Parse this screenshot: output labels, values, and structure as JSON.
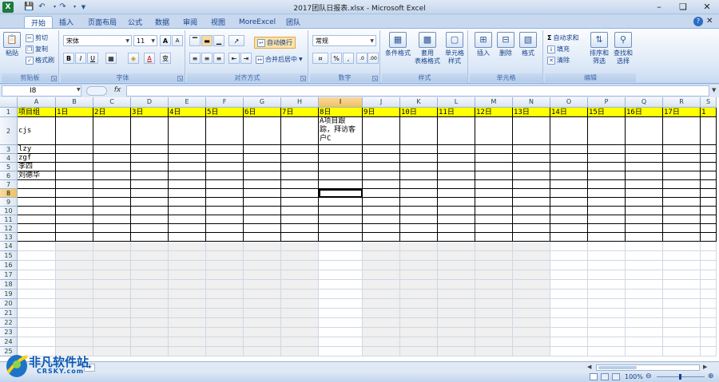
{
  "window": {
    "title": "2017团队日报表.xlsx - Microsoft Excel"
  },
  "tabs": [
    {
      "label": "开始"
    },
    {
      "label": "插入"
    },
    {
      "label": "页面布局"
    },
    {
      "label": "公式"
    },
    {
      "label": "数据"
    },
    {
      "label": "审阅"
    },
    {
      "label": "视图"
    },
    {
      "label": "MoreExcel"
    },
    {
      "label": "团队"
    }
  ],
  "ribbon": {
    "clipboard": {
      "label": "剪贴板",
      "paste": "粘贴",
      "cut": "剪切",
      "copy": "复制",
      "format_painter": "格式刷"
    },
    "font": {
      "label": "字体",
      "name": "宋体",
      "size": "11",
      "bold": "B",
      "italic": "I",
      "underline": "U",
      "grow": "A",
      "shrink": "A",
      "font_color": "A",
      "phonetic": "变"
    },
    "alignment": {
      "label": "对齐方式",
      "wrap": "自动换行",
      "merge": "合并后居中"
    },
    "number": {
      "label": "数字",
      "format": "常规",
      "percent": "%",
      "comma": ","
    },
    "styles": {
      "label": "样式",
      "conditional": "条件格式",
      "table": "套用",
      "table2": "表格格式",
      "cell_styles": "单元格",
      "cell_styles2": "样式"
    },
    "cells": {
      "label": "单元格",
      "insert": "插入",
      "delete": "删除",
      "format": "格式"
    },
    "editing": {
      "label": "编辑",
      "autosum": "自动求和",
      "fill": "填充",
      "clear": "清除",
      "sort": "排序和",
      "sort2": "筛选",
      "find": "查找和",
      "find2": "选择"
    }
  },
  "formula_bar": {
    "name_box": "I8",
    "fx": "fx",
    "content": ""
  },
  "columns": [
    "A",
    "B",
    "C",
    "D",
    "E",
    "F",
    "G",
    "H",
    "I",
    "J",
    "K",
    "L",
    "M",
    "N",
    "O",
    "P",
    "Q",
    "R",
    "S"
  ],
  "rows": [
    "1",
    "2",
    "3",
    "4",
    "5",
    "6",
    "7",
    "8",
    "9",
    "10",
    "11",
    "12",
    "13",
    "14",
    "15",
    "16",
    "17",
    "18",
    "19",
    "20",
    "21",
    "22",
    "23",
    "24",
    "25"
  ],
  "selected_cell": "I8",
  "header_row": [
    "项目组",
    "1日",
    "2日",
    "3日",
    "4日",
    "5日",
    "6日",
    "7日",
    "8日",
    "9日",
    "10日",
    "11日",
    "12日",
    "13日",
    "14日",
    "15日",
    "16日",
    "17日",
    "1"
  ],
  "cells": {
    "A2": "cjs",
    "I2": [
      "A项目跟",
      "踪，拜访客",
      "户C"
    ],
    "A3": "lzy",
    "A4": "zgf",
    "A5": "李四",
    "A6": "刘德华"
  },
  "status": {
    "zoom": "100%"
  },
  "watermark": {
    "text": "非凡软件站",
    "sub": "CRSKY.com"
  }
}
